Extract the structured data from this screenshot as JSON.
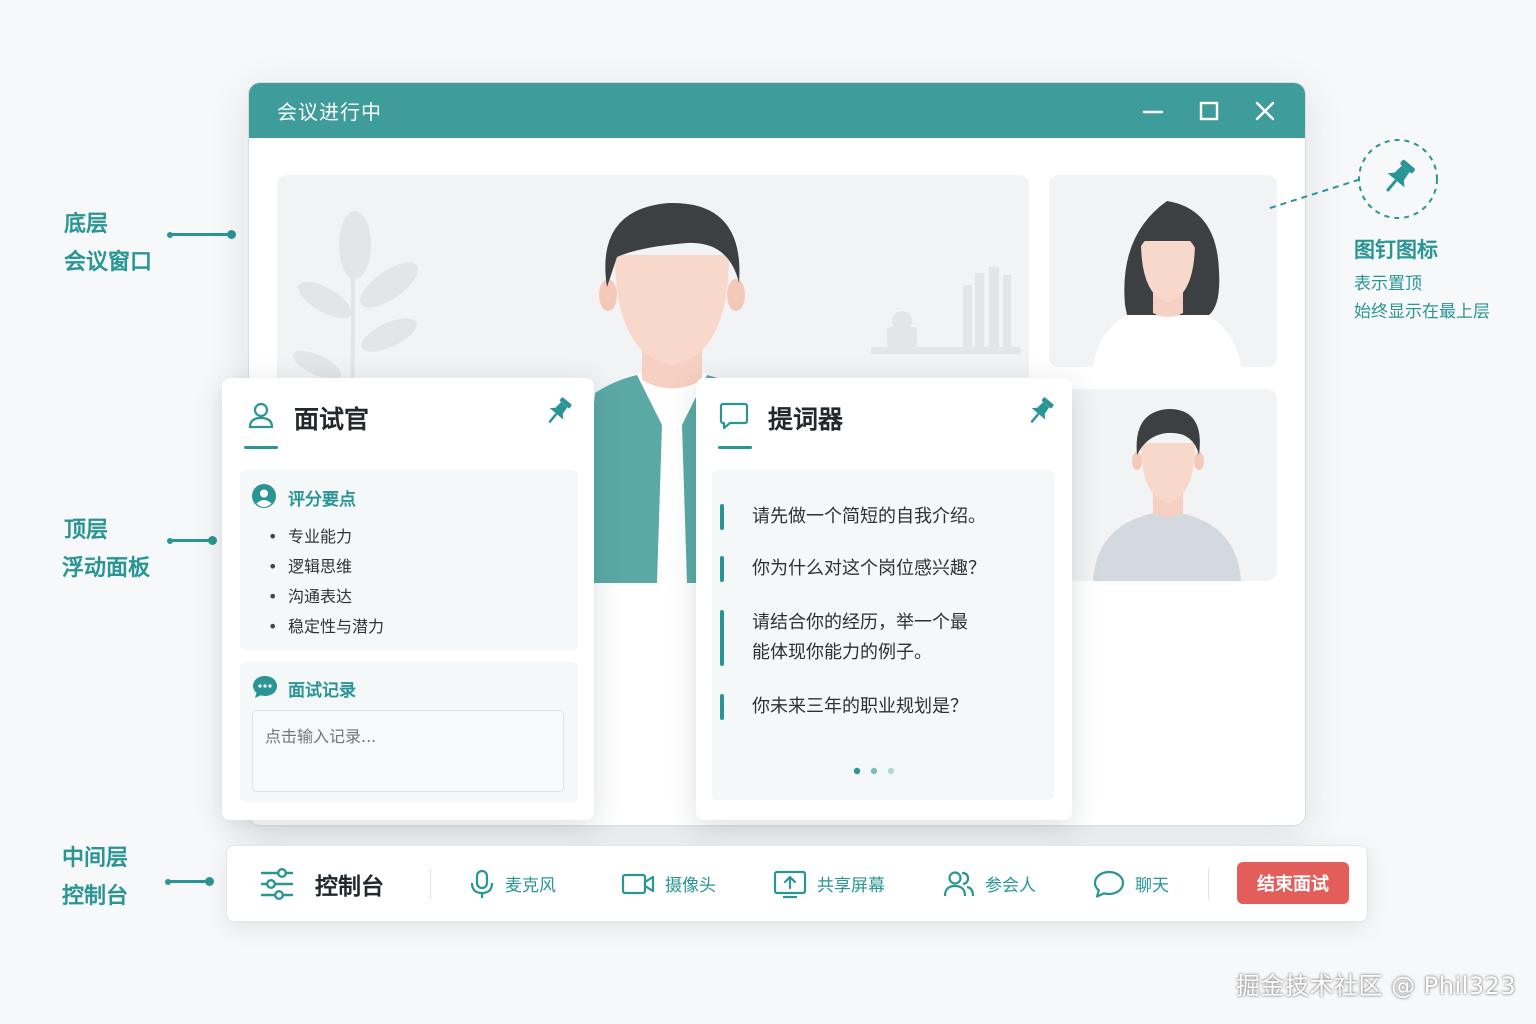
{
  "annotations": {
    "bottom_layer": {
      "line1": "底层",
      "line2": "会议窗口"
    },
    "top_layer": {
      "line1": "顶层",
      "line2": "浮动面板"
    },
    "middle_layer": {
      "line1": "中间层",
      "line2": "控制台"
    },
    "pin": {
      "title": "图钉图标",
      "line1": "表示置顶",
      "line2": "始终显示在最上层"
    }
  },
  "window": {
    "title": "会议进行中"
  },
  "interviewer_panel": {
    "title": "面试官",
    "scoring": {
      "title": "评分要点",
      "items": [
        "专业能力",
        "逻辑思维",
        "沟通表达",
        "稳定性与潜力"
      ]
    },
    "notes": {
      "title": "面试记录",
      "placeholder": "点击输入记录..."
    }
  },
  "prompter_panel": {
    "title": "提词器",
    "prompts": [
      "请先做一个简短的自我介绍。",
      "你为什么对这个岗位感兴趣？",
      "请结合你的经历，举一个最能体现你能力的例子。",
      "你未来三年的职业规划是？"
    ],
    "pager": {
      "pages": 3,
      "current": 1
    }
  },
  "control_bar": {
    "title": "控制台",
    "mic": "麦克风",
    "camera": "摄像头",
    "share": "共享屏幕",
    "participants": "参会人",
    "chat": "聊天",
    "end": "结束面试"
  },
  "watermark": "掘金技术社区 @ Phil323",
  "colors": {
    "accent": "#2a9595",
    "titlebar": "#3e9c9b",
    "danger": "#e35d5a"
  }
}
